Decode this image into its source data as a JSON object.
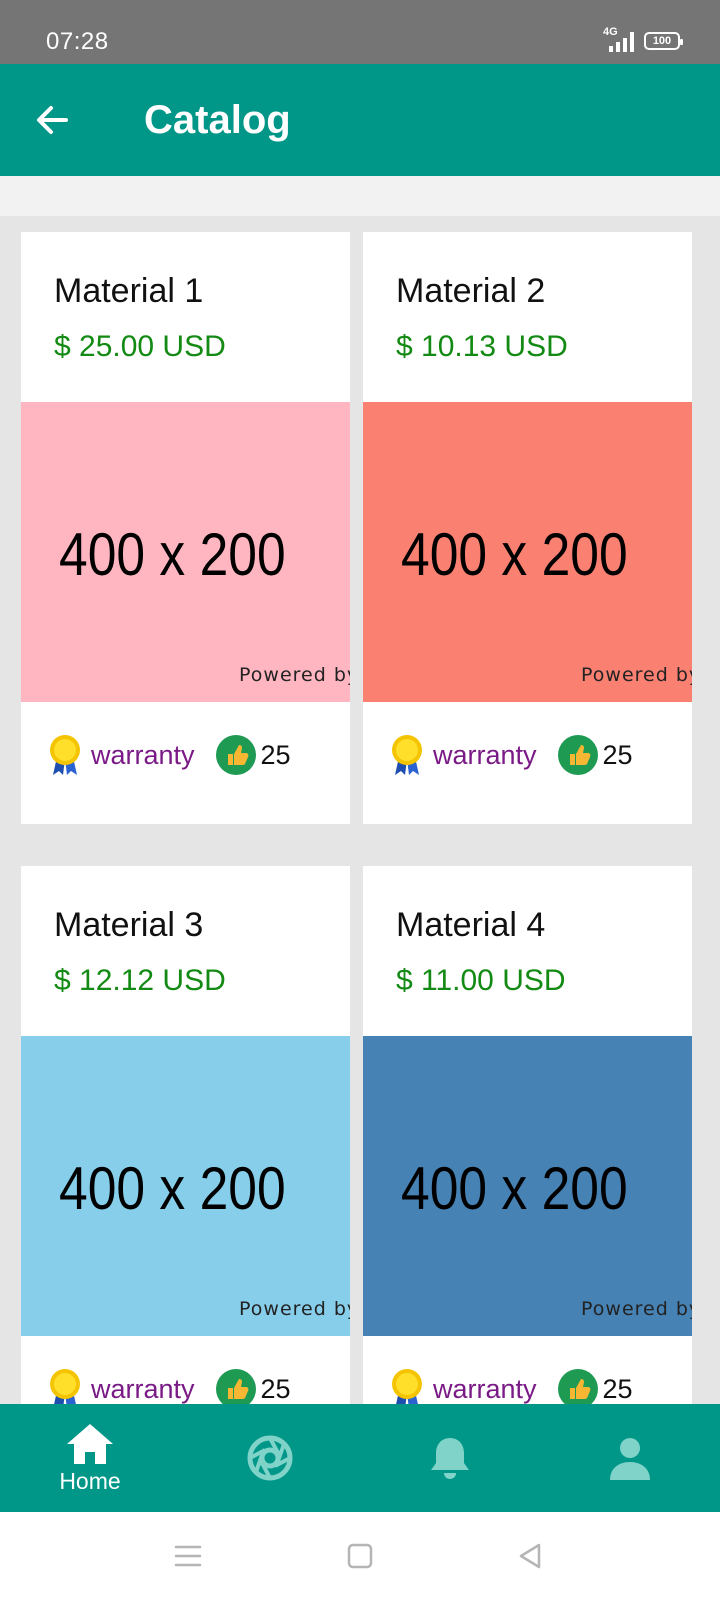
{
  "status_bar": {
    "time": "07:28",
    "network": "4G",
    "battery": "100"
  },
  "app_bar": {
    "title": "Catalog"
  },
  "image_placeholder": {
    "text": "400 x 200",
    "powered": "Powered by"
  },
  "products": [
    {
      "name": "Material 1",
      "price": "$ 25.00 USD",
      "image_color": "#ffb6c1",
      "warranty": "warranty",
      "likes": "25"
    },
    {
      "name": "Material 2",
      "price": "$ 10.13 USD",
      "image_color": "#fa8072",
      "warranty": "warranty",
      "likes": "25"
    },
    {
      "name": "Material 3",
      "price": "$ 12.12 USD",
      "image_color": "#87ceeb",
      "warranty": "warranty",
      "likes": "25"
    },
    {
      "name": "Material 4",
      "price": "$ 11.00 USD",
      "image_color": "#4682b4",
      "warranty": "warranty",
      "likes": "25"
    }
  ],
  "bottom_nav": {
    "items": [
      {
        "label": "Home",
        "icon": "home-icon",
        "active": true
      },
      {
        "label": "",
        "icon": "camera-shutter-icon",
        "active": false
      },
      {
        "label": "",
        "icon": "bell-icon",
        "active": false
      },
      {
        "label": "",
        "icon": "person-icon",
        "active": false
      }
    ]
  },
  "colors": {
    "primary": "#009688",
    "price": "#138a13",
    "warranty": "#7a1a86",
    "inactive_icon": "#7fd3c9"
  }
}
